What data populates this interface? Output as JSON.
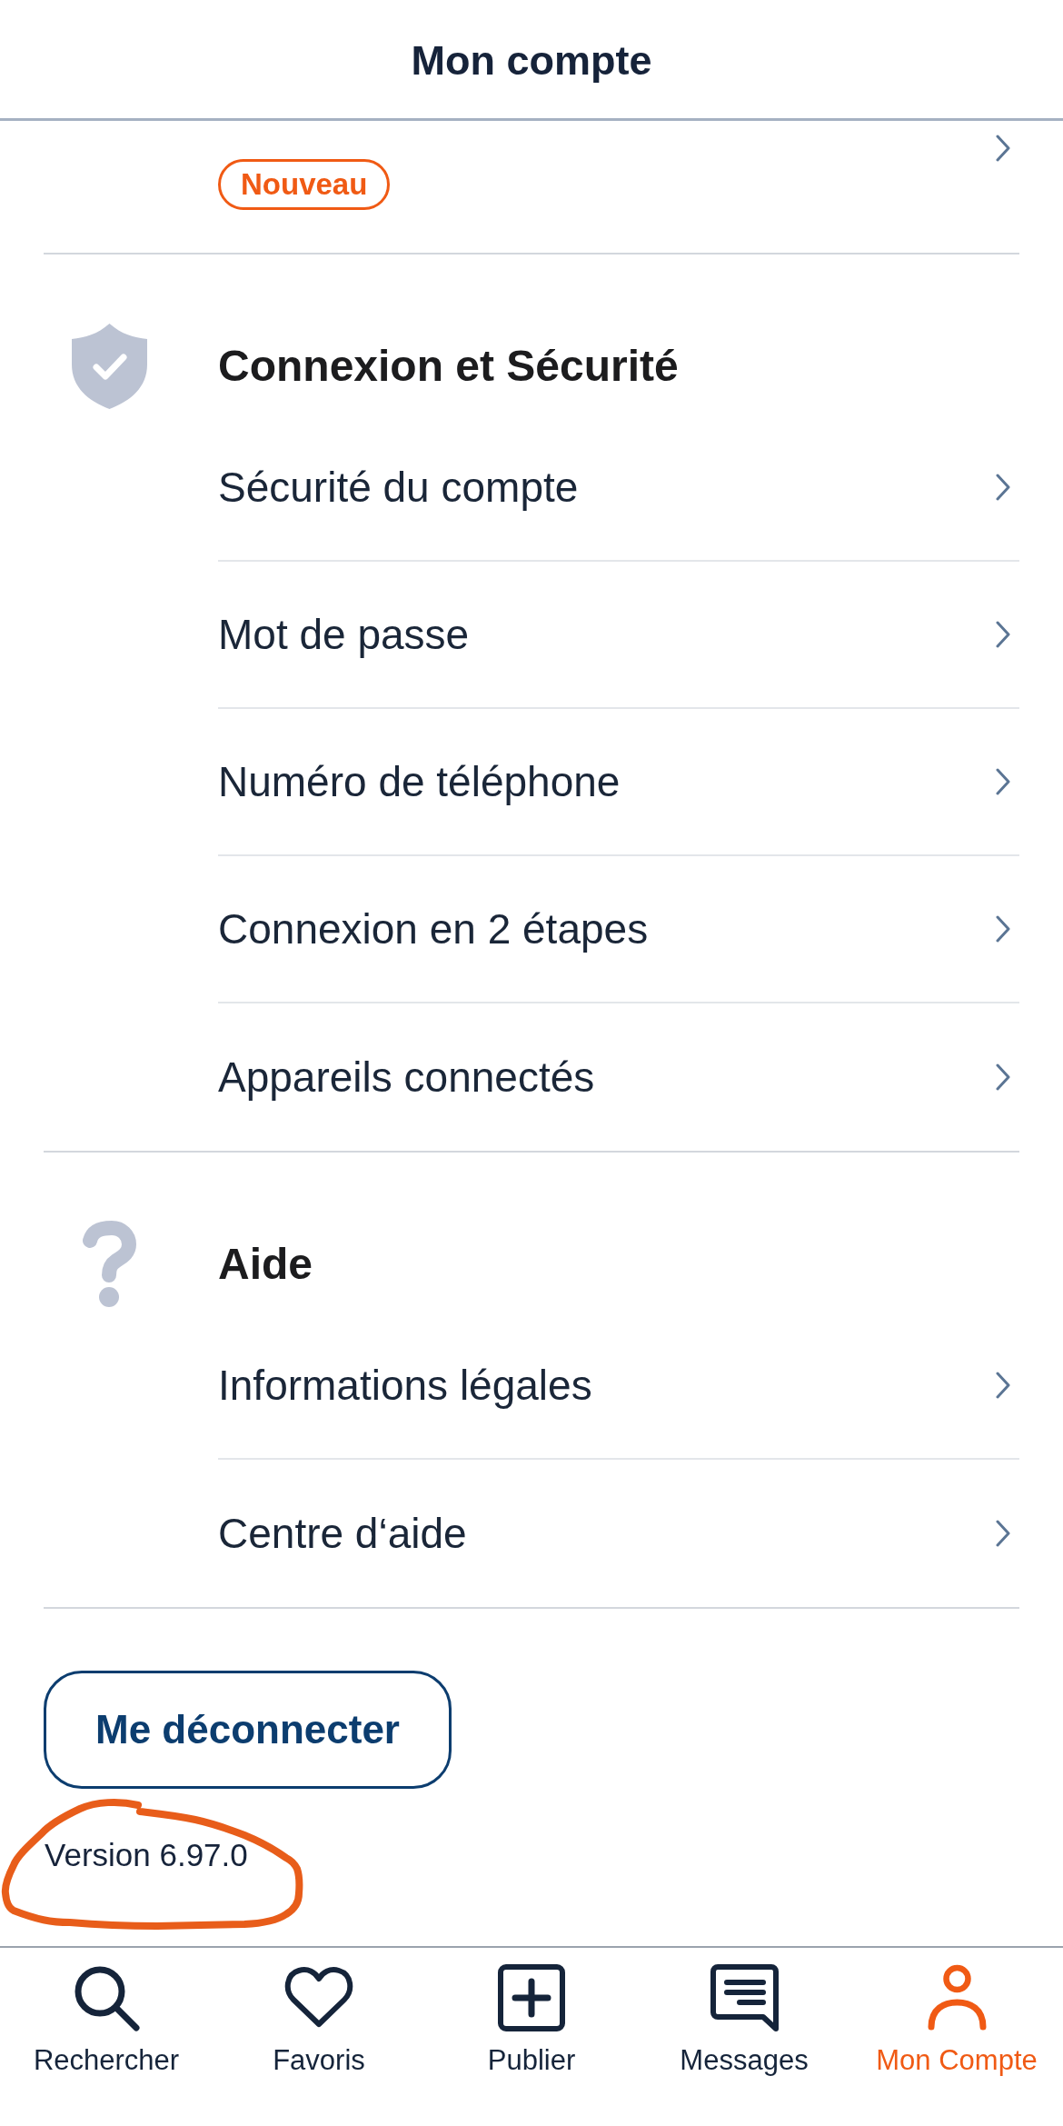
{
  "header": {
    "title": "Mon compte"
  },
  "partial_item": {
    "badge": "Nouveau"
  },
  "sections": [
    {
      "title": "Connexion et Sécurité",
      "items": [
        {
          "label": "Sécurité du compte"
        },
        {
          "label": "Mot de passe"
        },
        {
          "label": "Numéro de téléphone"
        },
        {
          "label": "Connexion en 2 étapes"
        },
        {
          "label": "Appareils connectés"
        }
      ]
    },
    {
      "title": "Aide",
      "items": [
        {
          "label": "Informations légales"
        },
        {
          "label": "Centre d‘aide"
        }
      ]
    }
  ],
  "logout_button": {
    "label": "Me déconnecter"
  },
  "version": "Version 6.97.0",
  "tab_bar": [
    {
      "label": "Rechercher",
      "selected": false
    },
    {
      "label": "Favoris",
      "selected": false
    },
    {
      "label": "Publier",
      "selected": false
    },
    {
      "label": "Messages",
      "selected": false
    },
    {
      "label": "Mon Compte",
      "selected": true
    }
  ]
}
